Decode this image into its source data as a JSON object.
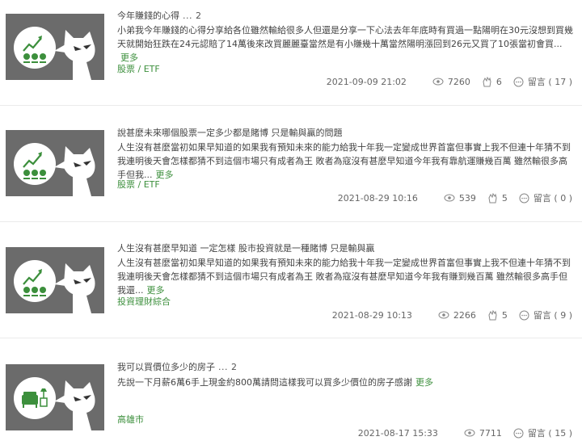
{
  "posts": [
    {
      "title": "今年賺錢的心得",
      "reply_count": "... 2",
      "excerpt": "小弟我今年賺錢的心得分享給各位雖然輸給很多人但還是分享一下心法去年年底時有買過一點陽明在30元沒想到買幾天就開始狂跌在24元認賠了14萬後來改買麗麗臺當然是有小賺幾十萬當然陽明漲回到26元又買了10張當初會買...",
      "more": "更多",
      "category": "股票 / ETF",
      "date": "2021-09-09 21:02",
      "views": "7260",
      "likes": "6",
      "comment_label": "留言",
      "comments": "( 17 )",
      "thumb_icon": "stock-chart-icon"
    },
    {
      "title": "說甚麼未來哪個股票一定多少都是賭博 只是輸與贏的問題",
      "reply_count": "",
      "excerpt": "人生沒有甚麼當初如果早知道的如果我有預知未來的能力給我十年我一定變成世界首富但事實上我不但連十年猜不到我連明後天會怎樣都猜不到這個市場只有成者為王 敗者為寇沒有甚麼早知道今年我有靠航運賺幾百萬 雖然輸很多高手但我...",
      "more": "更多",
      "category": "股票 / ETF",
      "date": "2021-08-29 10:16",
      "views": "539",
      "likes": "5",
      "comment_label": "留言",
      "comments": "( 0 )",
      "thumb_icon": "stock-chart-icon"
    },
    {
      "title": "人生沒有甚麼早知道 一定怎樣 股市投資就是一種賭博 只是輸與贏",
      "reply_count": "",
      "excerpt": "人生沒有甚麼當初如果早知道的如果我有預知未來的能力給我十年我一定變成世界首富但事實上我不但連十年猜不到我連明後天會怎樣都猜不到這個市場只有成者為王 敗者為寇沒有甚麼早知道今年我有賺到幾百萬 雖然輸很多高手但我還...",
      "more": "更多",
      "category": "投資理財綜合",
      "date": "2021-08-29 10:13",
      "views": "2266",
      "likes": "5",
      "comment_label": "留言",
      "comments": "( 9 )",
      "thumb_icon": "stock-chart-icon"
    },
    {
      "title": "我可以買價位多少的房子",
      "reply_count": "... 2",
      "excerpt": "先說一下月薪6萬6手上現金約800萬請問這樣我可以買多少價位的房子感謝",
      "more": "更多",
      "category": "高雄市",
      "date": "2021-08-17 15:33",
      "views": "7711",
      "likes": "",
      "comment_label": "留言",
      "comments": "( 15 )",
      "thumb_icon": "house-furniture-icon"
    }
  ],
  "colors": {
    "accent": "#3c8f3c",
    "thumb_bg": "#6b6b6b",
    "text": "#444444",
    "meta_text": "#666666"
  }
}
